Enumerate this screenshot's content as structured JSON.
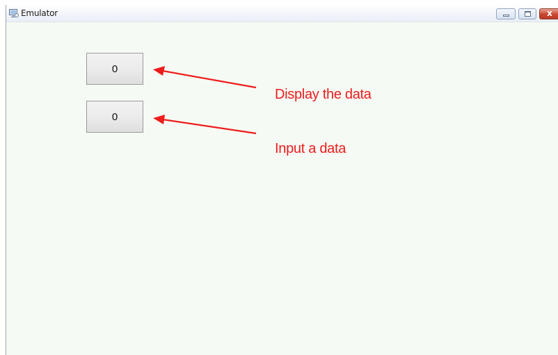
{
  "window": {
    "title": "Emulator",
    "controls": {
      "minimize": "minimize",
      "maximize": "maximize",
      "close": "x"
    }
  },
  "fields": {
    "display_value": "0",
    "input_value": "0"
  },
  "annotations": {
    "display_label": "Display the data",
    "input_label": "Input a data",
    "color": "#ee1c1c"
  },
  "colors": {
    "client_background": "#f6faf4",
    "field_border": "#9a9a9a",
    "close_button": "#c9452f"
  },
  "icons": {
    "app": "emulator-icon",
    "minimize": "minimize-icon",
    "maximize": "maximize-icon",
    "close": "close-icon"
  }
}
